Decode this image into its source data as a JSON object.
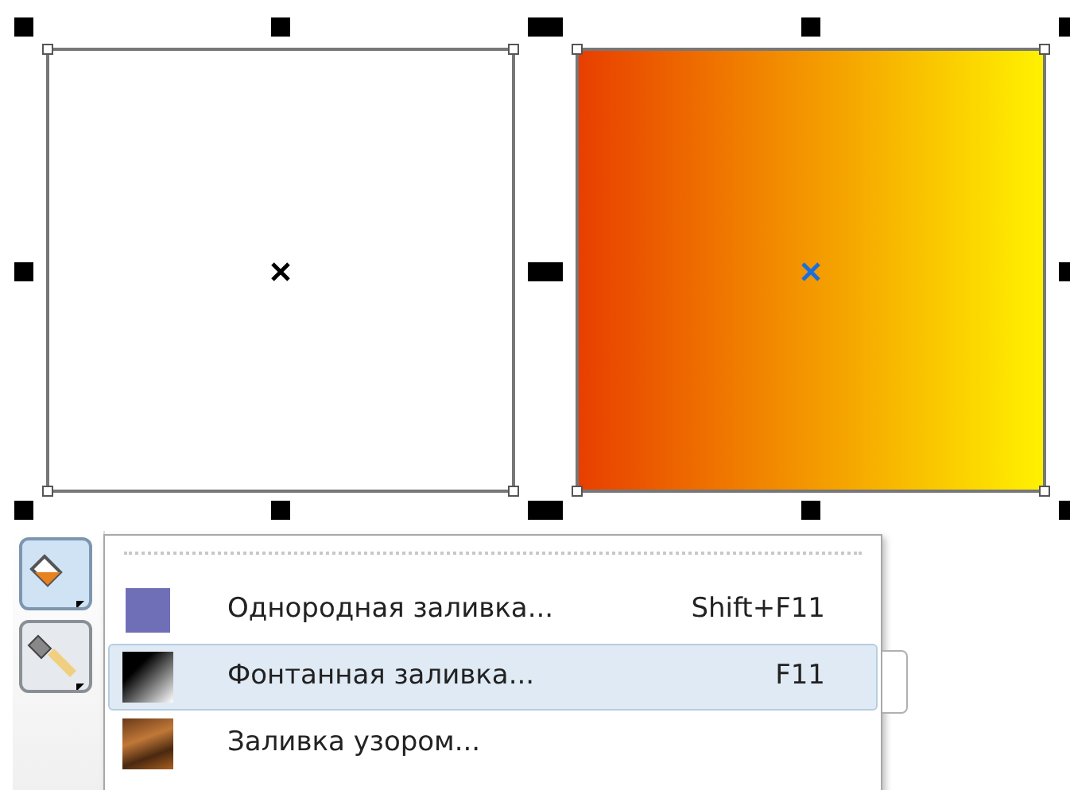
{
  "canvas": {
    "shapes": [
      {
        "kind": "plain"
      },
      {
        "kind": "gradient"
      }
    ]
  },
  "toolbox": {
    "buttons": [
      {
        "kind": "fill",
        "selected": true
      },
      {
        "kind": "outline",
        "selected": false
      }
    ]
  },
  "flyout_menu": {
    "items": [
      {
        "kind": "uniform",
        "label": "Однородная заливка...",
        "shortcut": "Shift+F11",
        "selected": false
      },
      {
        "kind": "fountain",
        "label": "Фонтанная заливка...",
        "shortcut": "F11",
        "selected": true
      },
      {
        "kind": "pattern",
        "label": "Заливка узором...",
        "selected": false
      }
    ]
  }
}
